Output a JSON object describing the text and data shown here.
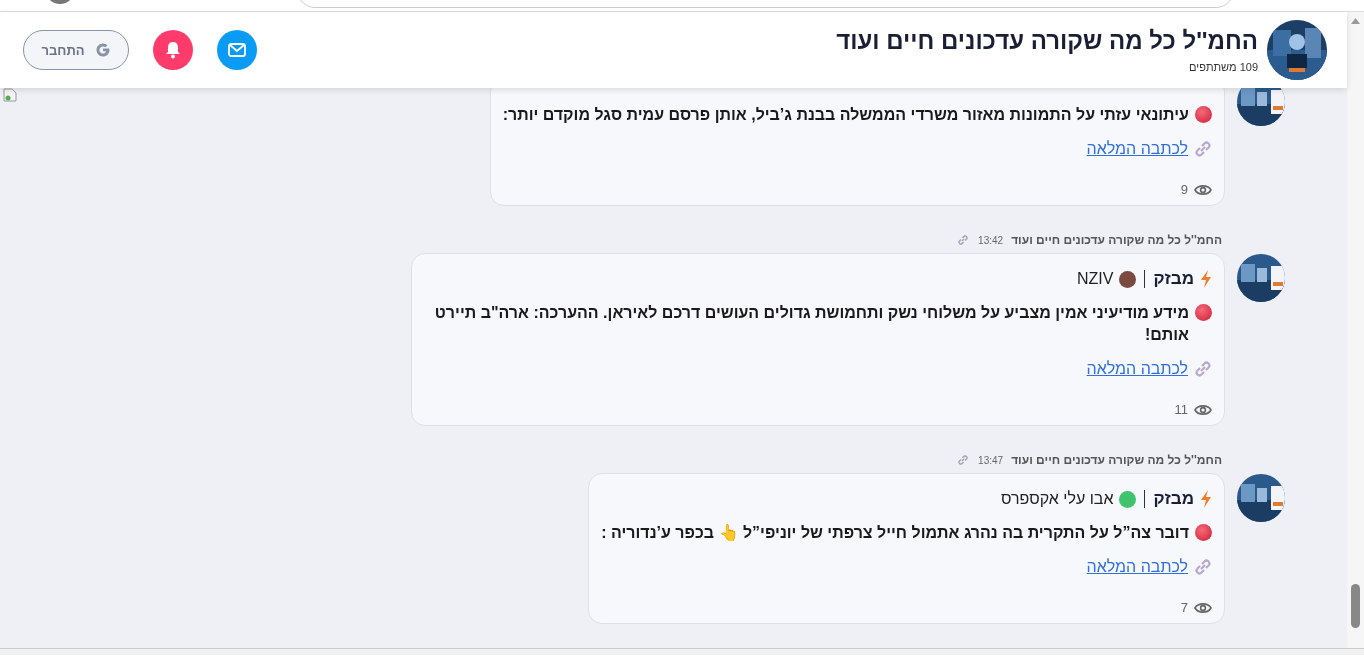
{
  "channel": {
    "title": "החמ''ל כל מה שקורה עדכונים חיים ועוד",
    "subscribers": "109 משתתפים"
  },
  "login_button": {
    "label": "התחבר"
  },
  "messages": [
    {
      "text": "עיתונאי עזתי על התמונות מאזור משרדי הממשלה בבנת ג’ביל, אותן פרסם עמית סגל מוקדם יותר:",
      "link": "לכתבה המלאה",
      "views": "9"
    },
    {
      "channel_name": "החמ''ל כל מה שקורה עדכונים חיים ועוד",
      "time": "13:42",
      "tag": "מבזק",
      "source": "NZIV",
      "color": "#7a4a3e",
      "text": "מידע מודיעיני אמין מצביע על משלוחי נשק ותחמושת גדולים העושים דרכם לאיראן. ההערכה: ארה\"ב תיירט אותם!",
      "link": "לכתבה המלאה",
      "views": "11"
    },
    {
      "channel_name": "החמ''ל כל מה שקורה עדכונים חיים ועוד",
      "time": "13:47",
      "tag": "מבזק",
      "source": "אבו עלי אקספרס",
      "color": "#3fc46d",
      "text": "דובר צה”ל על התקרית בה נהרג אתמול חייל צרפתי של יוניפי”ל 👆 בכפר ע’נדוריה :",
      "link": "לכתבה המלאה",
      "views": "7"
    }
  ]
}
